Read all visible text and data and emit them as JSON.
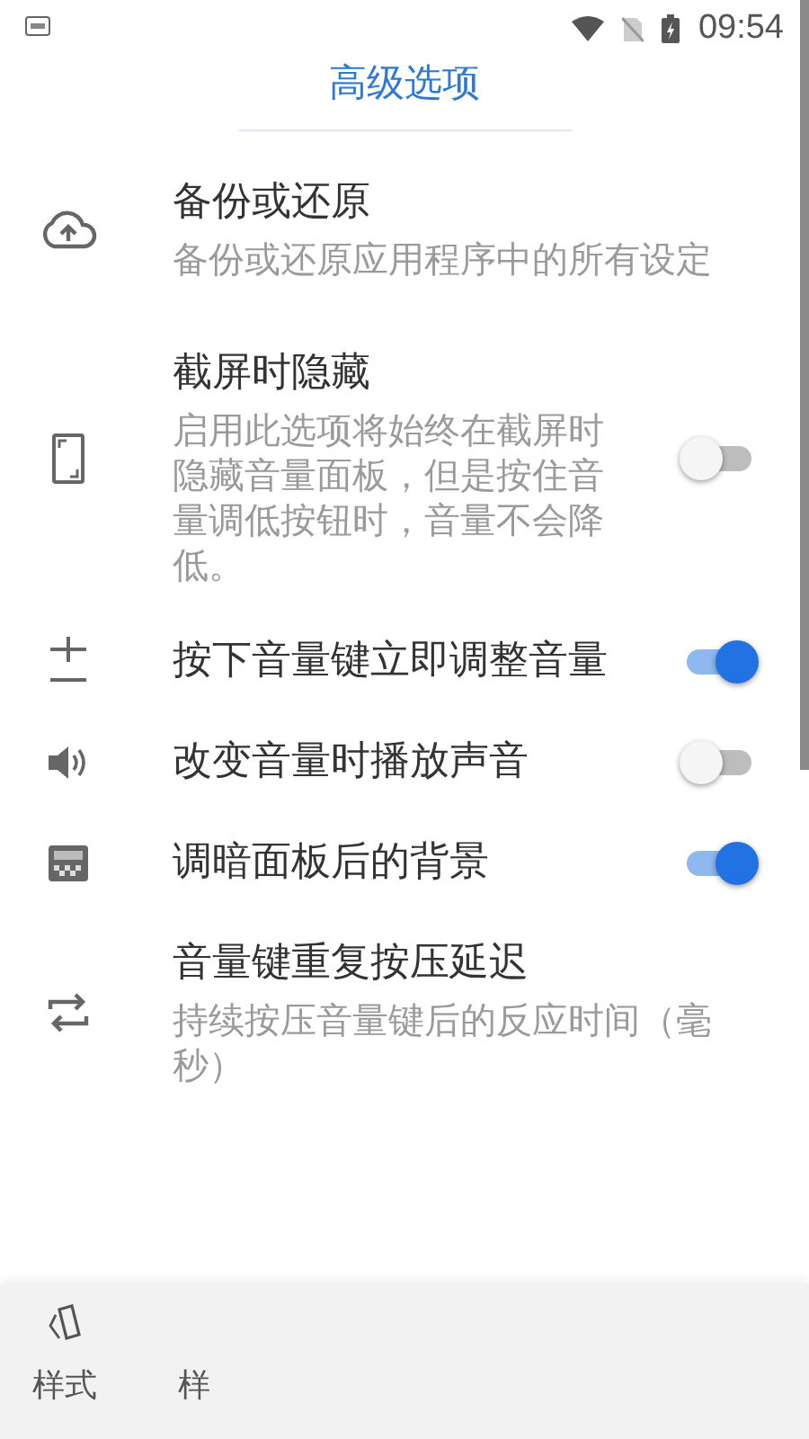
{
  "status_bar": {
    "time": "09:54"
  },
  "header": {
    "title": "高级选项"
  },
  "settings": [
    {
      "kind": "plain",
      "title": "备份或还原",
      "description": "备份或还原应用程序中的所有设定"
    },
    {
      "kind": "switch",
      "title": "截屏时隐藏",
      "description": "启用此选项将始终在截屏时隐藏音量面板，但是按住音量调低按钮时，音量不会降低。",
      "on": false
    },
    {
      "kind": "switch",
      "title": "按下音量键立即调整音量",
      "on": true
    },
    {
      "kind": "switch",
      "title": "改变音量时播放声音",
      "on": false
    },
    {
      "kind": "switch",
      "title": "调暗面板后的背景",
      "on": true
    },
    {
      "kind": "plain",
      "title": "音量键重复按压延迟",
      "description": "持续按压音量键后的反应时间（毫秒）"
    }
  ],
  "bottom_nav": [
    {
      "label": "样式"
    },
    {
      "label": "样"
    }
  ]
}
